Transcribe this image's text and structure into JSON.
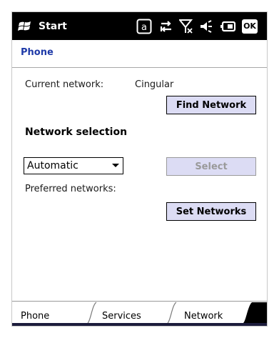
{
  "statusbar": {
    "start_label": "Start",
    "ok_label": "OK",
    "icons": [
      "windows-flag-icon",
      "a-indicator-icon",
      "data-connection-icon",
      "no-signal-icon",
      "speaker-icon",
      "battery-icon"
    ]
  },
  "page": {
    "title": "Phone"
  },
  "network": {
    "current_label": "Current network:",
    "current_value": "Cingular",
    "find_button": "Find Network",
    "selection_heading": "Network selection",
    "selection_value": "Automatic",
    "select_button": "Select",
    "preferred_label": "Preferred networks:",
    "set_button": "Set Networks"
  },
  "tabs": [
    {
      "label": "Phone",
      "active": false
    },
    {
      "label": "Services",
      "active": false
    },
    {
      "label": "Network",
      "active": true
    }
  ],
  "colors": {
    "title": "#1e3aa8",
    "button_bg": "#dcdcf4",
    "statusbar_bg": "#000000"
  }
}
